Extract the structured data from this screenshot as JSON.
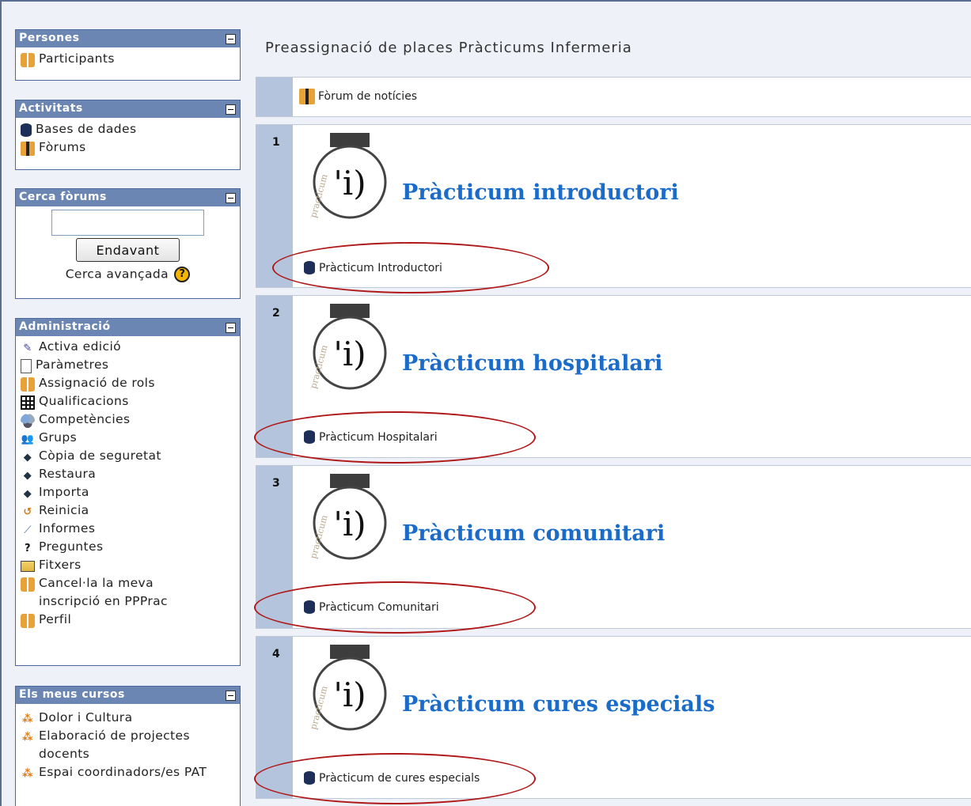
{
  "sidebar": {
    "persones": {
      "title": "Persones",
      "items": [
        "Participants"
      ]
    },
    "activitats": {
      "title": "Activitats",
      "items": [
        "Bases de dades",
        "Fòrums"
      ]
    },
    "cerca": {
      "title": "Cerca fòrums",
      "button": "Endavant",
      "advanced": "Cerca avançada"
    },
    "admin": {
      "title": "Administració",
      "items": [
        {
          "label": "Activa edició",
          "icon": "edit-icon"
        },
        {
          "label": "Paràmetres",
          "icon": "settings-icon"
        },
        {
          "label": "Assignació de rols",
          "icon": "roles-icon"
        },
        {
          "label": "Qualificacions",
          "icon": "grades-icon"
        },
        {
          "label": "Competències",
          "icon": "outcomes-icon"
        },
        {
          "label": "Grups",
          "icon": "groups-icon"
        },
        {
          "label": "Còpia de seguretat",
          "icon": "backup-icon"
        },
        {
          "label": "Restaura",
          "icon": "restore-icon"
        },
        {
          "label": "Importa",
          "icon": "import-icon"
        },
        {
          "label": "Reinicia",
          "icon": "reset-icon"
        },
        {
          "label": "Informes",
          "icon": "reports-icon"
        },
        {
          "label": "Preguntes",
          "icon": "questions-icon"
        },
        {
          "label": "Fitxers",
          "icon": "folder-icon"
        },
        {
          "label": "Cancel·la la meva inscripció en PPPrac",
          "icon": "unenrol-icon"
        },
        {
          "label": "Perfil",
          "icon": "profile-icon"
        }
      ]
    },
    "cursos": {
      "title": "Els meus cursos",
      "items": [
        "Dolor i Cultura",
        "Elaboració de projectes docents",
        "Espai coordinadors/es PAT"
      ]
    }
  },
  "main": {
    "course_title": "Preassignació de places Pràcticums Infermeria",
    "news_forum": "Fòrum de notícies",
    "sections": [
      {
        "num": "1",
        "heading": "Pràcticum introductori",
        "activity": "Pràcticum Introductori"
      },
      {
        "num": "2",
        "heading": "Pràcticum hospitalari",
        "activity": "Pràcticum Hospitalari"
      },
      {
        "num": "3",
        "heading": "Pràcticum comunitari",
        "activity": "Pràcticum Comunitari"
      },
      {
        "num": "4",
        "heading": "Pràcticum cures especials",
        "activity": "Pràcticum de cures especials"
      }
    ],
    "logo_text": "practicum",
    "logo_mark": "'i)"
  },
  "colors": {
    "block_header": "#6b86b3",
    "heading": "#1a6cc8",
    "annotation": "#b01818",
    "section_side": "#b3c4dc"
  }
}
